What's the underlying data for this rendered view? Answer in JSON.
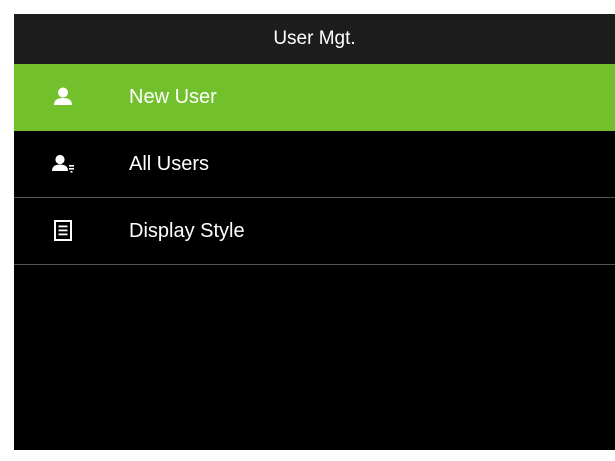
{
  "header": {
    "title": "User Mgt."
  },
  "menu": {
    "items": [
      {
        "label": "New User",
        "icon": "user-icon",
        "selected": true
      },
      {
        "label": "All Users",
        "icon": "users-list-icon",
        "selected": false
      },
      {
        "label": "Display Style",
        "icon": "display-style-icon",
        "selected": false
      }
    ]
  },
  "colors": {
    "selected_background": "#72c02c",
    "screen_background": "#000000",
    "title_background": "#1d1d1d",
    "text": "#ffffff"
  }
}
